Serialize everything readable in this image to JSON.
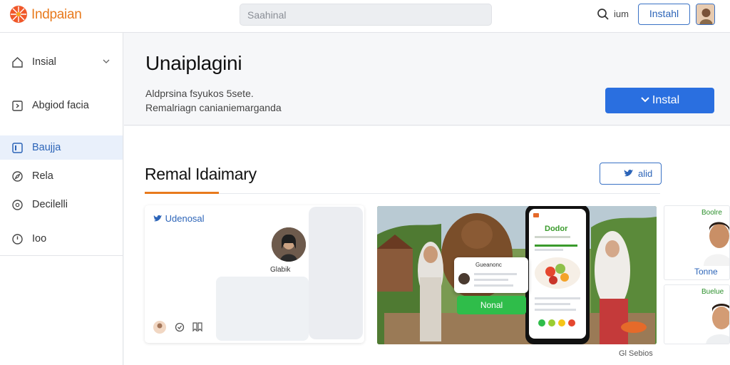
{
  "topbar": {
    "brand": "Indpaian",
    "search_placeholder": "Saahinal",
    "search_label": "ium",
    "install_label": "Instahl"
  },
  "sidebar": {
    "items": [
      {
        "label": "Insial",
        "icon": "home-icon"
      },
      {
        "label": "Abgiod facia",
        "icon": "tag-icon"
      },
      {
        "label": "Baujja",
        "icon": "square-icon"
      },
      {
        "label": "Rela",
        "icon": "compass-icon"
      },
      {
        "label": "Decilelli",
        "icon": "info-icon"
      },
      {
        "label": "Ioo",
        "icon": "clock-icon"
      }
    ]
  },
  "hero": {
    "title": "Unaiplagini",
    "desc1": "Aldprsina fsyukos 5sete.",
    "desc2": "Remalriagn canianiemarganda",
    "install_button": "Instal"
  },
  "section": {
    "title": "Remal Idaimary",
    "action_label": "alid"
  },
  "card1": {
    "tag": "Udenosal",
    "caption": "Glabik"
  },
  "card2": {
    "phone_title": "Dodor",
    "green_button": "Nonal",
    "popup_label": "Gueanonc"
  },
  "card3": {
    "tag": "Boolre",
    "name": "Tonne"
  },
  "card4": {
    "tag": "Buelue"
  },
  "footer": {
    "link": "Gl Sebios"
  },
  "colors": {
    "accent": "#2a6fe0",
    "brand": "#e87a1d",
    "green": "#2fbd4a"
  }
}
